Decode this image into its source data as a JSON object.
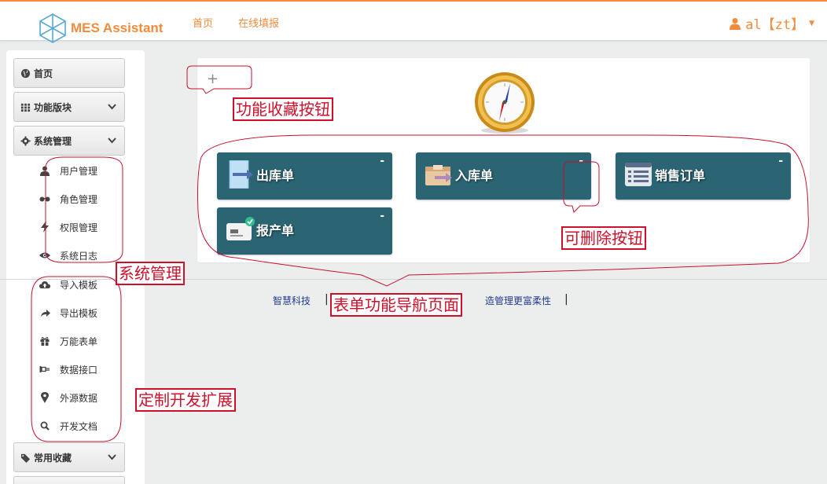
{
  "header": {
    "brand": "MES Assistant",
    "nav": [
      "首页",
      "在线填报"
    ],
    "user": "al【zt】",
    "brand_color": "#f28c3c"
  },
  "sidebar": {
    "sections": [
      {
        "label": "首页",
        "icon": "globe-icon"
      },
      {
        "label": "功能版块",
        "icon": "grid-icon"
      },
      {
        "label": "系统管理",
        "icon": "gear-icon"
      },
      {
        "label": "常用收藏",
        "icon": "tags-icon"
      }
    ],
    "system_items": [
      {
        "label": "用户管理",
        "icon": "user-icon"
      },
      {
        "label": "角色管理",
        "icon": "glasses-icon"
      },
      {
        "label": "权限管理",
        "icon": "bolt-icon"
      },
      {
        "label": "系统日志",
        "icon": "eye-icon"
      }
    ],
    "custom_items": [
      {
        "label": "导入模板",
        "icon": "cloud-upload-icon"
      },
      {
        "label": "导出模板",
        "icon": "share-arrow-icon"
      },
      {
        "label": "万能表单",
        "icon": "gift-icon"
      },
      {
        "label": "数据接口",
        "icon": "plug-icon"
      },
      {
        "label": "外源数据",
        "icon": "map-marker-icon"
      },
      {
        "label": "开发文档",
        "icon": "search-icon"
      }
    ]
  },
  "main": {
    "add_label": "+",
    "tiles": [
      {
        "label": "出库单",
        "icon": "outbound-icon",
        "delete": "-"
      },
      {
        "label": "入库单",
        "icon": "inbound-icon",
        "delete": "-"
      },
      {
        "label": "销售订单",
        "icon": "sales-order-icon",
        "delete": "-"
      },
      {
        "label": "报产单",
        "icon": "production-report-icon",
        "delete": "-"
      }
    ],
    "tile_color": "#2b6574"
  },
  "footer": {
    "left": "智慧科技",
    "sep": "|",
    "right": "造管理更富柔性"
  },
  "annotations": {
    "favorite_button": "功能收藏按钮",
    "deletable_button": "可删除按钮",
    "system_management": "系统管理",
    "form_navigation_page": "表单功能导航页面",
    "custom_extension": "定制开发扩展",
    "color": "#d0102a"
  }
}
